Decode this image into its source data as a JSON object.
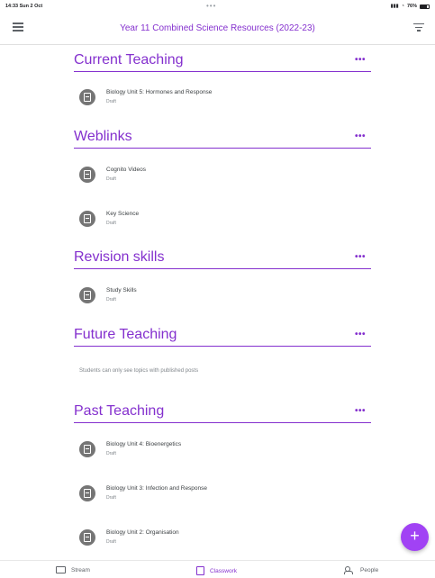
{
  "status_bar": {
    "time": "14:33  Sun 2 Oct",
    "battery": "76%"
  },
  "app_bar": {
    "title": "Year 11 Combined Science Resources (2022-23)"
  },
  "topics": [
    {
      "title": "Current Teaching",
      "more": "•••",
      "items": [
        {
          "name": "Biology Unit 5: Hormones and Response",
          "status": "Draft"
        }
      ]
    },
    {
      "title": "Weblinks",
      "more": "•••",
      "items": [
        {
          "name": "Cognito Videos",
          "status": "Draft"
        },
        {
          "name": "Key Science",
          "status": "Draft"
        }
      ]
    },
    {
      "title": "Revision skills",
      "more": "•••",
      "items": [
        {
          "name": "Study Skills",
          "status": "Draft"
        }
      ]
    },
    {
      "title": "Future Teaching",
      "more": "•••",
      "note": "Students can only see topics with published posts",
      "items": []
    },
    {
      "title": "Past Teaching",
      "more": "•••",
      "items": [
        {
          "name": "Biology Unit 4: Bioenergetics",
          "status": "Draft"
        },
        {
          "name": "Biology Unit 3: Infection and Response",
          "status": "Draft"
        },
        {
          "name": "Biology Unit 2: Organisation",
          "status": "Draft"
        }
      ]
    }
  ],
  "fab": {
    "label": "+"
  },
  "bottom_nav": {
    "items": [
      {
        "label": "Stream",
        "icon": "stream-icon"
      },
      {
        "label": "Classwork",
        "icon": "classwork-icon",
        "active": true
      },
      {
        "label": "People",
        "icon": "people-icon"
      }
    ]
  },
  "colors": {
    "accent": "#8430ce",
    "fab": "#a142f4",
    "item_icon": "#757575"
  }
}
